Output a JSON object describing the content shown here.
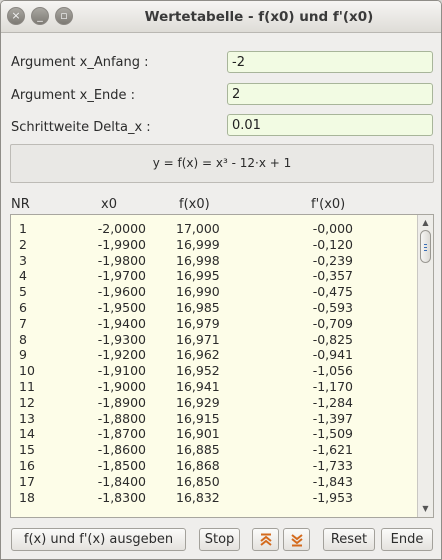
{
  "window": {
    "title": "Wertetabelle - f(x0) und f'(x0)",
    "controls": {
      "close": "×",
      "minimize": "_",
      "maximize": "▫"
    }
  },
  "form": {
    "start_label": "Argument x_Anfang :",
    "start_value": "-2",
    "end_label": "Argument x_Ende :",
    "end_value": "2",
    "step_label": "Schrittweite Delta_x :",
    "step_value": "0.01"
  },
  "formula": "y = f(x) = x³ - 12·x + 1",
  "table": {
    "headers": {
      "nr": "NR",
      "x0": "x0",
      "fx0": "f(x0)",
      "dfx0": "f'(x0)"
    },
    "rows": [
      {
        "nr": "1",
        "x0": "-2,0000",
        "fx0": "17,000",
        "dfx0": "-0,000"
      },
      {
        "nr": "2",
        "x0": "-1,9900",
        "fx0": "16,999",
        "dfx0": "-0,120"
      },
      {
        "nr": "3",
        "x0": "-1,9800",
        "fx0": "16,998",
        "dfx0": "-0,239"
      },
      {
        "nr": "4",
        "x0": "-1,9700",
        "fx0": "16,995",
        "dfx0": "-0,357"
      },
      {
        "nr": "5",
        "x0": "-1,9600",
        "fx0": "16,990",
        "dfx0": "-0,475"
      },
      {
        "nr": "6",
        "x0": "-1,9500",
        "fx0": "16,985",
        "dfx0": "-0,593"
      },
      {
        "nr": "7",
        "x0": "-1,9400",
        "fx0": "16,979",
        "dfx0": "-0,709"
      },
      {
        "nr": "8",
        "x0": "-1,9300",
        "fx0": "16,971",
        "dfx0": "-0,825"
      },
      {
        "nr": "9",
        "x0": "-1,9200",
        "fx0": "16,962",
        "dfx0": "-0,941"
      },
      {
        "nr": "10",
        "x0": "-1,9100",
        "fx0": "16,952",
        "dfx0": "-1,056"
      },
      {
        "nr": "11",
        "x0": "-1,9000",
        "fx0": "16,941",
        "dfx0": "-1,170"
      },
      {
        "nr": "12",
        "x0": "-1,8900",
        "fx0": "16,929",
        "dfx0": "-1,284"
      },
      {
        "nr": "13",
        "x0": "-1,8800",
        "fx0": "16,915",
        "dfx0": "-1,397"
      },
      {
        "nr": "14",
        "x0": "-1,8700",
        "fx0": "16,901",
        "dfx0": "-1,509"
      },
      {
        "nr": "15",
        "x0": "-1,8600",
        "fx0": "16,885",
        "dfx0": "-1,621"
      },
      {
        "nr": "16",
        "x0": "-1,8500",
        "fx0": "16,868",
        "dfx0": "-1,733"
      },
      {
        "nr": "17",
        "x0": "-1,8400",
        "fx0": "16,850",
        "dfx0": "-1,843"
      },
      {
        "nr": "18",
        "x0": "-1,8300",
        "fx0": "16,832",
        "dfx0": "-1,953"
      }
    ]
  },
  "buttons": {
    "compute": "f(x) und f'(x) ausgeben",
    "stop": "Stop",
    "scroll_top_icon": "double-chevron-up-icon",
    "scroll_bottom_icon": "double-chevron-down-icon",
    "reset": "Reset",
    "end": "Ende"
  },
  "colors": {
    "input_background": "#f2fbe3",
    "list_background": "#fdfde8",
    "accent_orange": "#d46a1c"
  }
}
